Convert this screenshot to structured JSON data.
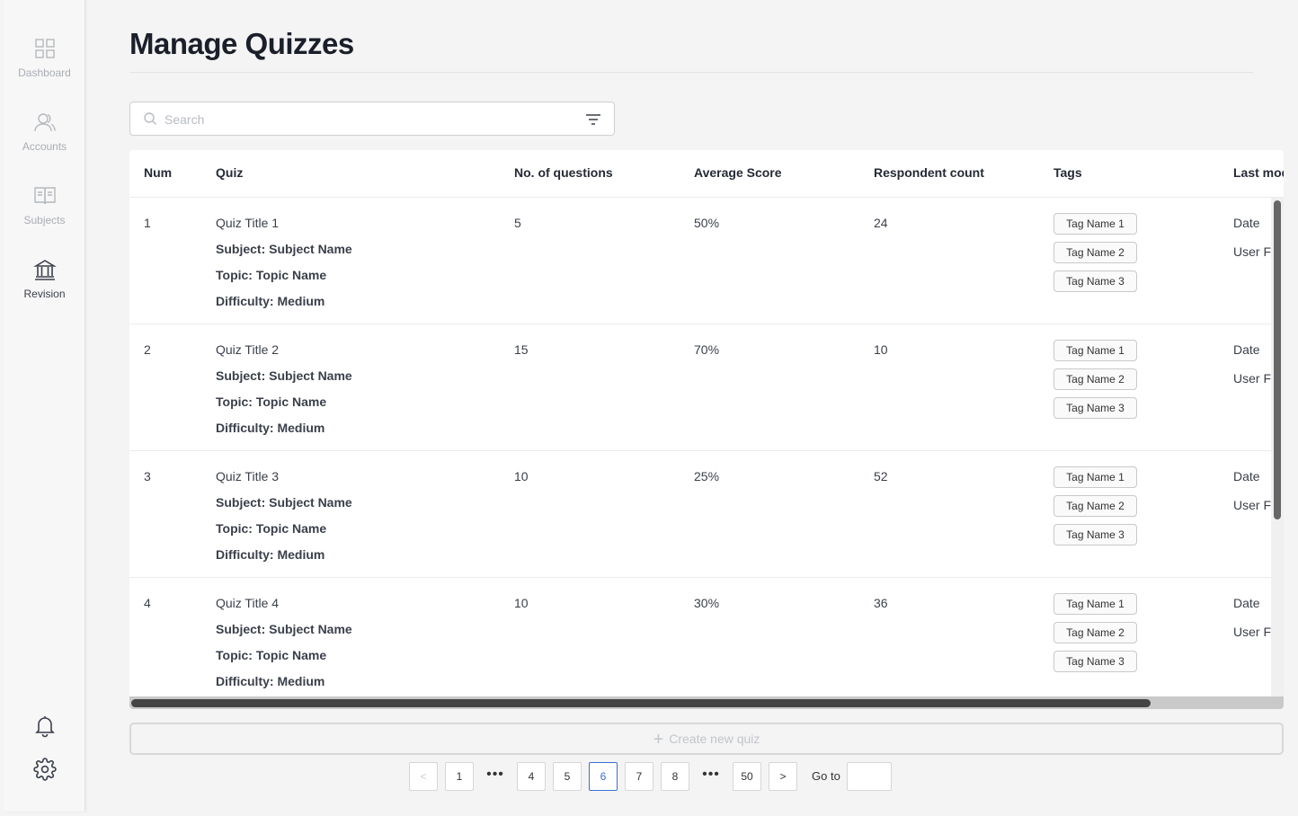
{
  "sidebar": {
    "items": [
      {
        "label": "Dashboard",
        "icon": "dashboard-grid-icon"
      },
      {
        "label": "Accounts",
        "icon": "users-icon"
      },
      {
        "label": "Subjects",
        "icon": "book-icon"
      },
      {
        "label": "Revision",
        "icon": "institution-icon"
      }
    ],
    "active": "Revision",
    "bottom_icons": [
      "bell-icon",
      "gear-icon"
    ]
  },
  "page": {
    "title": "Manage Quizzes"
  },
  "search": {
    "placeholder": "Search",
    "value": ""
  },
  "table": {
    "columns": [
      "Num",
      "Quiz",
      "No. of questions",
      "Average Score",
      "Respondent count",
      "Tags",
      "Last mod"
    ],
    "rows": [
      {
        "num": "1",
        "title": "Quiz Title 1",
        "subject": "Subject: Subject Name",
        "topic": "Topic: Topic Name",
        "difficulty": "Difficulty: Medium",
        "questions": "5",
        "avg": "50%",
        "respondents": "24",
        "tags": [
          "Tag Name 1",
          "Tag Name 2",
          "Tag Name 3"
        ],
        "date": "Date",
        "user": "User Fu"
      },
      {
        "num": "2",
        "title": "Quiz Title 2",
        "subject": "Subject: Subject Name",
        "topic": "Topic: Topic Name",
        "difficulty": "Difficulty: Medium",
        "questions": "15",
        "avg": "70%",
        "respondents": "10",
        "tags": [
          "Tag Name 1",
          "Tag Name 2",
          "Tag Name 3"
        ],
        "date": "Date",
        "user": "User Fu"
      },
      {
        "num": "3",
        "title": "Quiz Title 3",
        "subject": "Subject: Subject Name",
        "topic": "Topic: Topic Name",
        "difficulty": "Difficulty: Medium",
        "questions": "10",
        "avg": "25%",
        "respondents": "52",
        "tags": [
          "Tag Name 1",
          "Tag Name 2",
          "Tag Name 3"
        ],
        "date": "Date",
        "user": "User Fu"
      },
      {
        "num": "4",
        "title": "Quiz Title 4",
        "subject": "Subject: Subject Name",
        "topic": "Topic: Topic Name",
        "difficulty": "Difficulty: Medium",
        "questions": "10",
        "avg": "30%",
        "respondents": "36",
        "tags": [
          "Tag Name 1",
          "Tag Name 2",
          "Tag Name 3"
        ],
        "date": "Date",
        "user": "User Fu"
      }
    ]
  },
  "create_button": {
    "label": "Create new quiz"
  },
  "pagination": {
    "prev": "<",
    "next": ">",
    "pages": [
      "1",
      "...",
      "4",
      "5",
      "6",
      "7",
      "8",
      "...",
      "50"
    ],
    "current": "6",
    "goto_label": "Go to",
    "goto_value": ""
  },
  "colors": {
    "accent": "#3b6fd8",
    "text": "#1f2430",
    "background": "#f4f4f4"
  }
}
